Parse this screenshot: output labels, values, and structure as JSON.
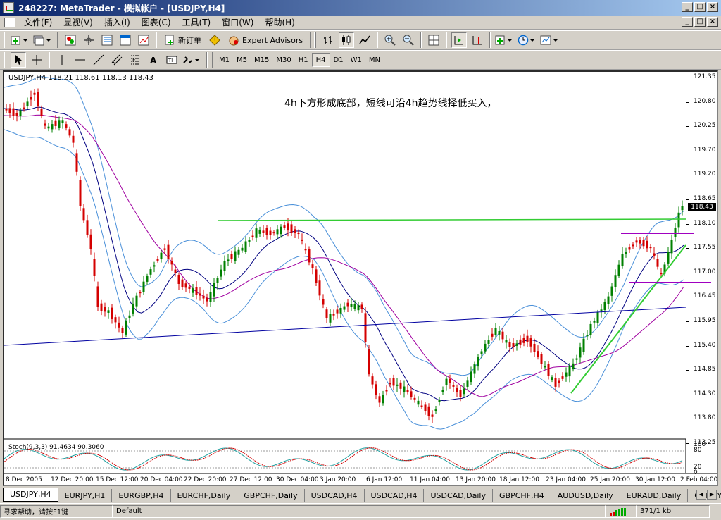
{
  "window": {
    "title": "248227: MetaTrader - 模拟帐户 - [USDJPY,H4]",
    "min_label": "_",
    "max_label": "□",
    "close_label": "×"
  },
  "menu": {
    "items": [
      "文件(F)",
      "显视(V)",
      "插入(I)",
      "图表(C)",
      "工具(T)",
      "窗口(W)",
      "帮助(H)"
    ]
  },
  "toolbar": {
    "new_order_label": "新订单",
    "expert_advisors_label": "Expert Advisors"
  },
  "timeframes": [
    "M1",
    "M5",
    "M15",
    "M30",
    "H1",
    "H4",
    "D1",
    "W1",
    "MN"
  ],
  "active_timeframe": "H4",
  "chart": {
    "symbol_info": "USDJPY,H4  118.21 118.61 118.13 118.43",
    "annotation": "4h下方形成底部，短线可沿4h趋势线择低买入，",
    "current_price": "118.43",
    "price_labels": [
      "121.35",
      "120.80",
      "120.25",
      "119.70",
      "119.20",
      "118.65",
      "118.10",
      "117.55",
      "117.00",
      "116.45",
      "115.95",
      "115.40",
      "114.85",
      "114.30",
      "113.80",
      "113.25"
    ],
    "stoch_info": "Stoch(9,3,3) 91.4634 90.3060",
    "stoch_labels": [
      "100",
      "80",
      "20",
      "0"
    ],
    "date_labels": [
      "8 Dec 2005",
      "12 Dec 20:00",
      "15 Dec 12:00",
      "20 Dec 04:00",
      "22 Dec 20:00",
      "27 Dec 12:00",
      "30 Dec 04:00",
      "3 Jan 20:00",
      "6 Jan 12:00",
      "11 Jan 04:00",
      "13 Jan 20:00",
      "18 Jan 12:00",
      "23 Jan 04:00",
      "25 Jan 20:00",
      "30 Jan 12:00",
      "2 Feb 04:00"
    ],
    "colors": {
      "bull": "#008000",
      "bear": "#d40000",
      "bands": "#4a90d9",
      "ma_fast": "#000080",
      "ma_slow": "#a000a0",
      "resistance": "#33cc33",
      "trendline": "#33cc33",
      "support": "#a000c0",
      "longtrend": "#0000a0",
      "stoch_main": "#20a0a0",
      "stoch_signal": "#d00000"
    }
  },
  "tabs": [
    "USDJPY,H4",
    "EURJPY,H1",
    "EURGBP,H4",
    "EURCHF,Daily",
    "GBPCHF,Daily",
    "USDCAD,H4",
    "USDCAD,H4",
    "USDCAD,Daily",
    "GBPCHF,H4",
    "AUDUSD,Daily",
    "EURAUD,Daily",
    "GBPJPY,I"
  ],
  "status": {
    "help": "寻求帮助，请按F1键",
    "profile": "Default",
    "traffic": "371/1 kb"
  }
}
